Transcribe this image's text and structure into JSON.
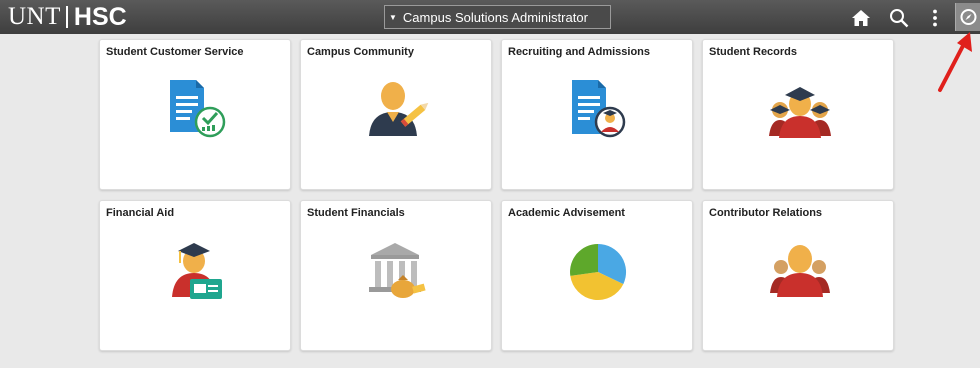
{
  "header": {
    "logo_left": "UNT",
    "logo_right": "HSC",
    "homepage_selector": "Campus Solutions Administrator",
    "icons": [
      "home-icon",
      "search-icon",
      "actions-menu-icon",
      "navbar-icon"
    ]
  },
  "tiles": [
    {
      "label": "Student Customer Service",
      "icon": "document-check-icon"
    },
    {
      "label": "Campus Community",
      "icon": "person-pencil-icon"
    },
    {
      "label": "Recruiting and Admissions",
      "icon": "document-person-icon"
    },
    {
      "label": "Student Records",
      "icon": "graduates-group-icon"
    },
    {
      "label": "Financial Aid",
      "icon": "graduate-card-icon"
    },
    {
      "label": "Student Financials",
      "icon": "bank-money-icon"
    },
    {
      "label": "Academic Advisement",
      "icon": "pie-chart-icon"
    },
    {
      "label": "Contributor Relations",
      "icon": "people-group-icon"
    }
  ],
  "colors": {
    "header_bg": "#444444",
    "tile_bg": "#ffffff",
    "page_bg": "#e9e9e9",
    "accent_blue": "#2d8fd5",
    "accent_red": "#c9302c",
    "annotation_arrow": "#e0201c"
  }
}
